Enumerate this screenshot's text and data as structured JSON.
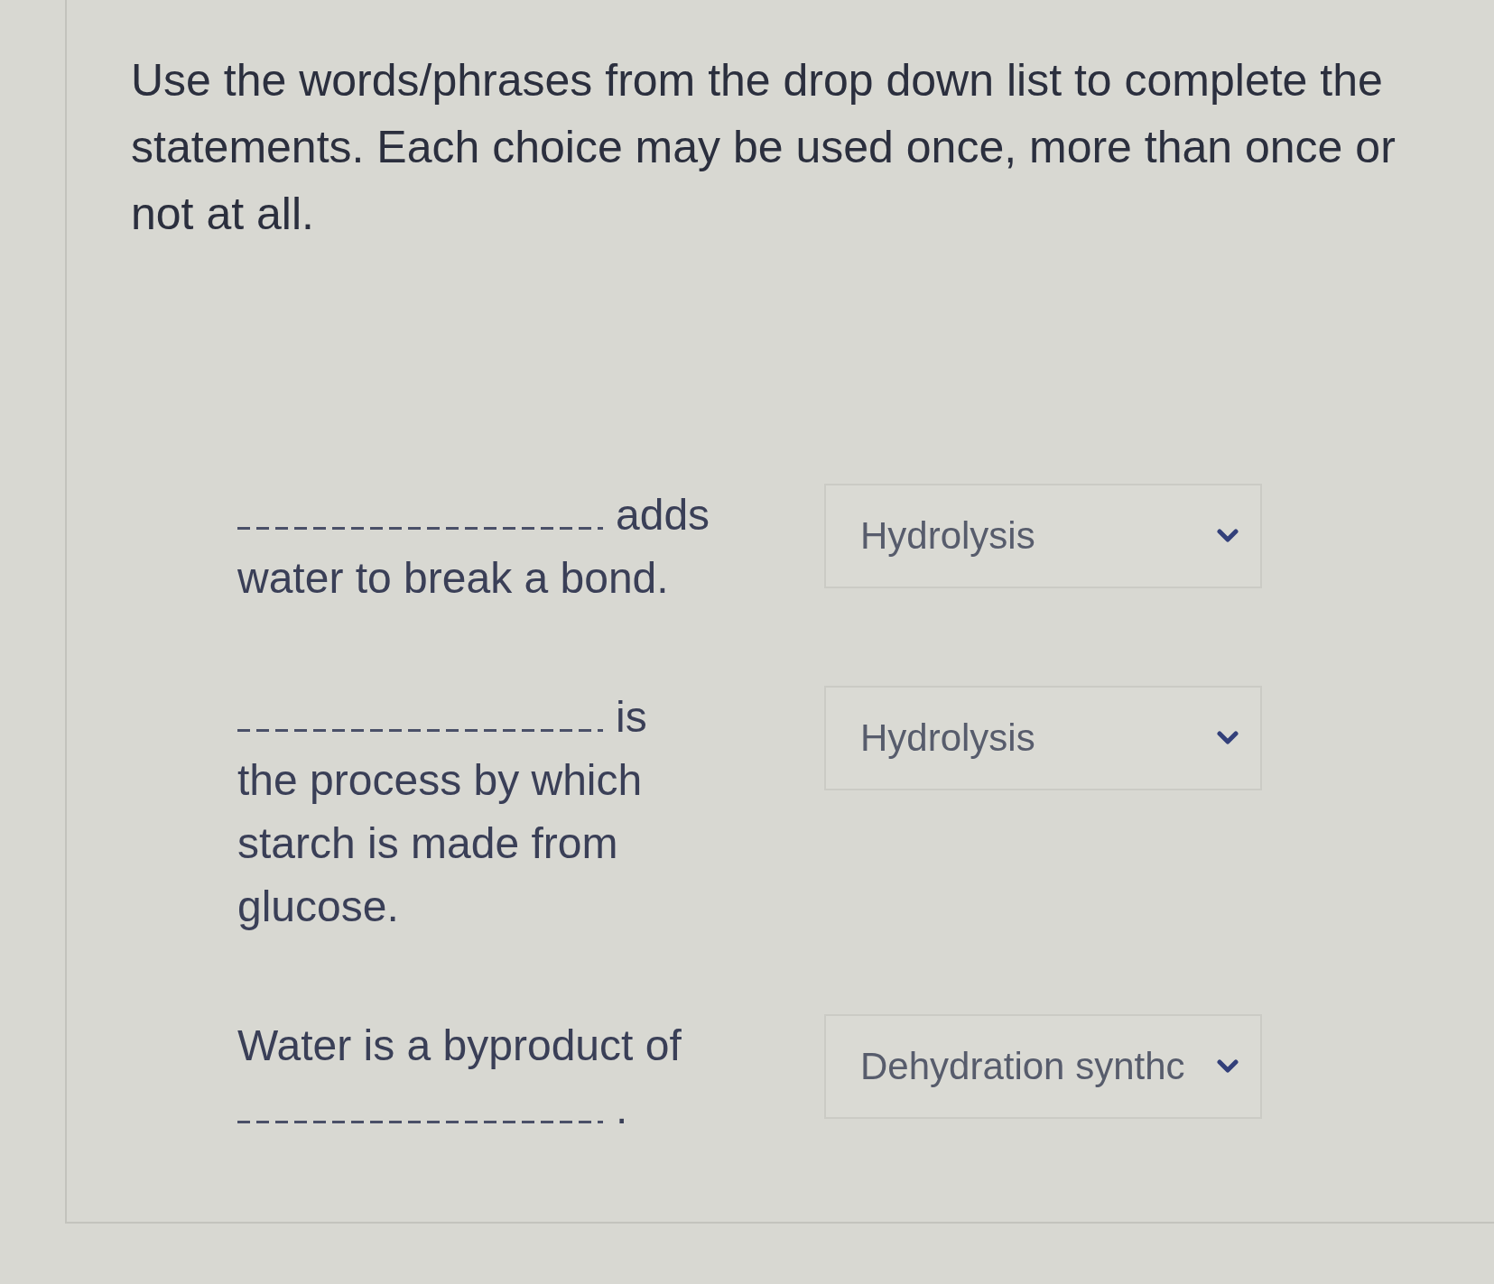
{
  "instructions": "Use the words/phrases from the drop down list to complete the statements. Each choice may be used once, more than once or not at all.",
  "questions": [
    {
      "statement": [
        {
          "kind": "blank"
        },
        {
          "kind": "text",
          "text": "adds"
        },
        {
          "kind": "text",
          "text": "water to break a bond."
        }
      ],
      "dropdown": {
        "value": "Hydrolysis"
      }
    },
    {
      "statement": [
        {
          "kind": "blank"
        },
        {
          "kind": "text",
          "text": "is"
        },
        {
          "kind": "text",
          "text": "the process by which starch is made from glucose."
        }
      ],
      "dropdown": {
        "value": "Hydrolysis"
      }
    },
    {
      "statement": [
        {
          "kind": "text",
          "text": "Water is a byproduct of"
        },
        {
          "kind": "blank"
        },
        {
          "kind": "text",
          "text": "."
        }
      ],
      "dropdown": {
        "value": "Dehydration synthc"
      }
    }
  ]
}
